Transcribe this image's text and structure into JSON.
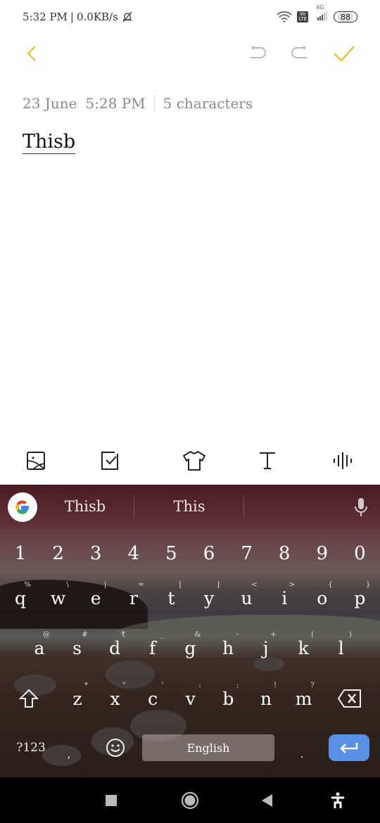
{
  "status_bar": {
    "time": "5:32 PM",
    "separator": "|",
    "net_speed": "0.0KB/s",
    "volte_top": "Vo",
    "volte_bottom": "LTE",
    "network": "4G",
    "battery": "88",
    "icons": [
      "silent-bell-icon",
      "wifi-icon",
      "volte-icon",
      "signal-icon",
      "battery-icon"
    ]
  },
  "toolbar": {
    "back": "back",
    "undo": "undo",
    "redo": "redo",
    "done": "done",
    "accent_color": "#f0b429"
  },
  "note": {
    "date": "23 June",
    "time": "5:28 PM",
    "char_count": "5 characters",
    "body": "Thisb"
  },
  "format_bar": {
    "items": [
      "image",
      "checklist",
      "theme",
      "text-format",
      "voice"
    ]
  },
  "keyboard": {
    "suggestions": [
      "Thisb",
      "This"
    ],
    "number_row": [
      "1",
      "2",
      "3",
      "4",
      "5",
      "6",
      "7",
      "8",
      "9",
      "0"
    ],
    "row1": [
      {
        "key": "q",
        "hint": "%"
      },
      {
        "key": "w",
        "hint": "\\"
      },
      {
        "key": "e",
        "hint": "|"
      },
      {
        "key": "r",
        "hint": "="
      },
      {
        "key": "t",
        "hint": "["
      },
      {
        "key": "y",
        "hint": "]"
      },
      {
        "key": "u",
        "hint": "<"
      },
      {
        "key": "i",
        "hint": ">"
      },
      {
        "key": "o",
        "hint": "{"
      },
      {
        "key": "p",
        "hint": "}"
      }
    ],
    "row2": [
      {
        "key": "a",
        "hint": "@"
      },
      {
        "key": "s",
        "hint": "#"
      },
      {
        "key": "d",
        "hint": "₹"
      },
      {
        "key": "f",
        "hint": "_"
      },
      {
        "key": "g",
        "hint": "&"
      },
      {
        "key": "h",
        "hint": "-"
      },
      {
        "key": "j",
        "hint": "+"
      },
      {
        "key": "k",
        "hint": "("
      },
      {
        "key": "l",
        "hint": ")"
      }
    ],
    "row3": [
      {
        "key": "z",
        "hint": "*"
      },
      {
        "key": "x",
        "hint": "\""
      },
      {
        "key": "c",
        "hint": "'"
      },
      {
        "key": "v",
        "hint": ":"
      },
      {
        "key": "b",
        "hint": ";"
      },
      {
        "key": "n",
        "hint": "!"
      },
      {
        "key": "m",
        "hint": "?"
      }
    ],
    "symbols_label": "?123",
    "comma": ",",
    "space_label": "English",
    "period": ".",
    "enter_color": "#5a8fe6"
  },
  "nav_bar": {
    "buttons": [
      "recents",
      "home",
      "back",
      "accessibility"
    ]
  }
}
